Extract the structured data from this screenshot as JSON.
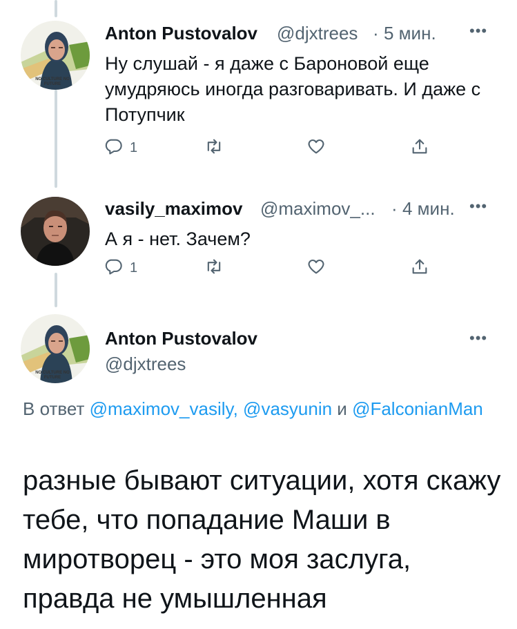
{
  "tweets": [
    {
      "name": "Anton Pustovalov",
      "handle": "@djxtrees",
      "sep": "·",
      "time": "5 мин.",
      "text": "Ну слушай - я даже с Бароновой еще умудряюсь иногда разговаривать. И даже с Потупчик",
      "reply_count": "1",
      "avatar_caption": "NO CULTURE NO FUTURE"
    },
    {
      "name": "vasily_maximov",
      "handle": "@maximov_...",
      "sep": "·",
      "time": "4 мин.",
      "text": "А я - нет. Зачем?",
      "reply_count": "1"
    }
  ],
  "main_tweet": {
    "name": "Anton Pustovalov",
    "handle": "@djxtrees",
    "avatar_caption": "NO CULTURE NO FUTURE",
    "reply_prefix": "В ответ",
    "mention_1": "@maximov_vasily,",
    "mention_2": "@vasyunin",
    "reply_and": "и",
    "mention_3": "@FalconianMan",
    "text": "разные бывают ситуации, хотя скажу тебе, что попадание Маши в миротворец - это моя заслуга, правда не умышленная"
  },
  "icons": [
    "reply-icon",
    "retweet-icon",
    "like-icon",
    "share-icon",
    "more-icon"
  ],
  "colors": {
    "text": "#0f1419",
    "secondary": "#536471",
    "link": "#1d9bf0",
    "thread_line": "#cfd9de"
  }
}
